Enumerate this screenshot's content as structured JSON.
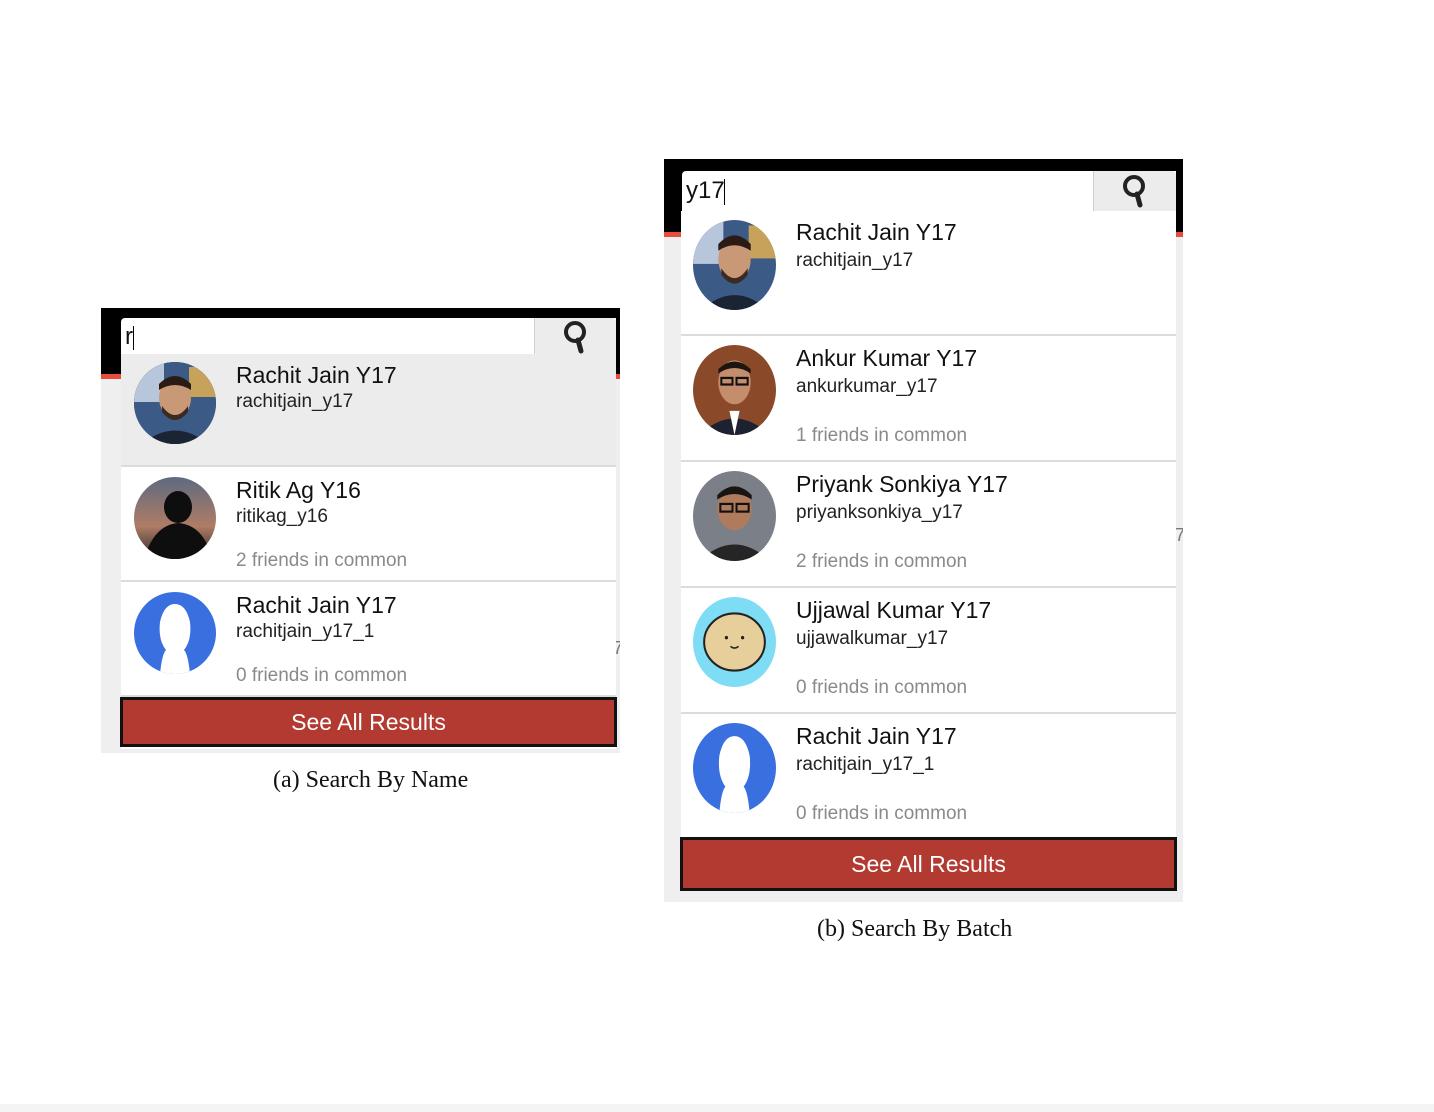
{
  "panel_a": {
    "search_value": "r",
    "results": [
      {
        "name": "Rachit Jain Y17",
        "handle": "rachitjain_y17",
        "common": "",
        "avatar": "avatar-rachit-photo"
      },
      {
        "name": "Ritik Ag Y16",
        "handle": "ritikag_y16",
        "common": "2 friends in common",
        "avatar": "avatar-silhouette-photo"
      },
      {
        "name": "Rachit Jain Y17",
        "handle": "rachitjain_y17_1",
        "common": "0 friends in common",
        "avatar": "avatar-default-blue"
      }
    ],
    "see_all": "See All Results",
    "caption": "(a) Search By Name"
  },
  "panel_b": {
    "search_value": "y17",
    "results": [
      {
        "name": "Rachit Jain Y17",
        "handle": "rachitjain_y17",
        "common": "",
        "avatar": "avatar-rachit-photo"
      },
      {
        "name": "Ankur Kumar Y17",
        "handle": "ankurkumar_y17",
        "common": "1 friends in common",
        "avatar": "avatar-ankur-photo"
      },
      {
        "name": "Priyank Sonkiya Y17",
        "handle": "priyanksonkiya_y17",
        "common": "2 friends in common",
        "avatar": "avatar-priyank-photo"
      },
      {
        "name": "Ujjawal Kumar Y17",
        "handle": "ujjawalkumar_y17",
        "common": "0 friends in common",
        "avatar": "avatar-potato-cartoon"
      },
      {
        "name": "Rachit Jain Y17",
        "handle": "rachitjain_y17_1",
        "common": "0 friends in common",
        "avatar": "avatar-default-blue"
      }
    ],
    "see_all": "See All Results",
    "caption": "(b) Search By Batch"
  },
  "colors": {
    "topbar": "#000000",
    "accent_red": "#e74c3c",
    "button_red": "#b23a30",
    "default_avatar_blue": "#3a6fe0",
    "potato_bg": "#7fdcf5"
  },
  "icons": {
    "search": "magnifier-icon"
  }
}
